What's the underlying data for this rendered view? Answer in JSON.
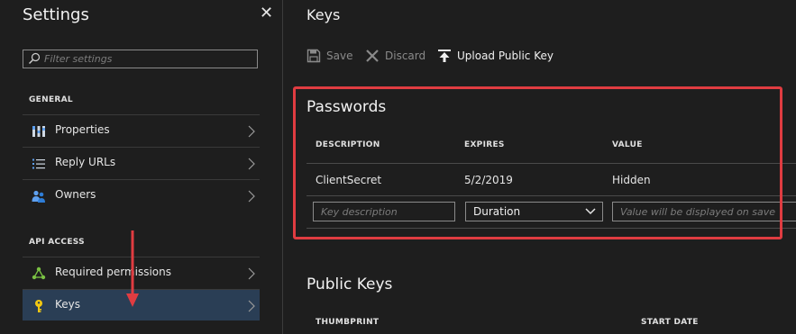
{
  "settings": {
    "title": "Settings",
    "close_glyph": "✕",
    "filter_placeholder": "Filter settings",
    "general_header": "GENERAL",
    "general_items": [
      {
        "label": "Properties",
        "icon": "properties-icon"
      },
      {
        "label": "Reply URLs",
        "icon": "list-icon"
      },
      {
        "label": "Owners",
        "icon": "users-icon"
      }
    ],
    "api_header": "API ACCESS",
    "api_items": [
      {
        "label": "Required permissions",
        "icon": "permissions-icon"
      },
      {
        "label": "Keys",
        "icon": "key-icon",
        "selected": true
      }
    ]
  },
  "keys": {
    "title": "Keys",
    "toolbar": {
      "save": "Save",
      "discard": "Discard",
      "upload": "Upload Public Key"
    },
    "passwords": {
      "title": "Passwords",
      "columns": [
        "DESCRIPTION",
        "EXPIRES",
        "VALUE"
      ],
      "rows": [
        {
          "description": "ClientSecret",
          "expires": "5/2/2019",
          "value": "Hidden"
        }
      ],
      "new_row": {
        "description_placeholder": "Key description",
        "duration_value": "Duration",
        "value_placeholder": "Value will be displayed on save"
      }
    },
    "public_keys": {
      "title": "Public Keys",
      "columns": [
        "THUMBPRINT",
        "START DATE"
      ]
    }
  },
  "colors": {
    "background": "#1e1e1e",
    "selected_item": "#2a3e55",
    "highlight_annotation": "#e03c41",
    "key_icon": "#f2c811",
    "icon_blue": "#5ea0ef",
    "icon_green": "#7ac143"
  }
}
